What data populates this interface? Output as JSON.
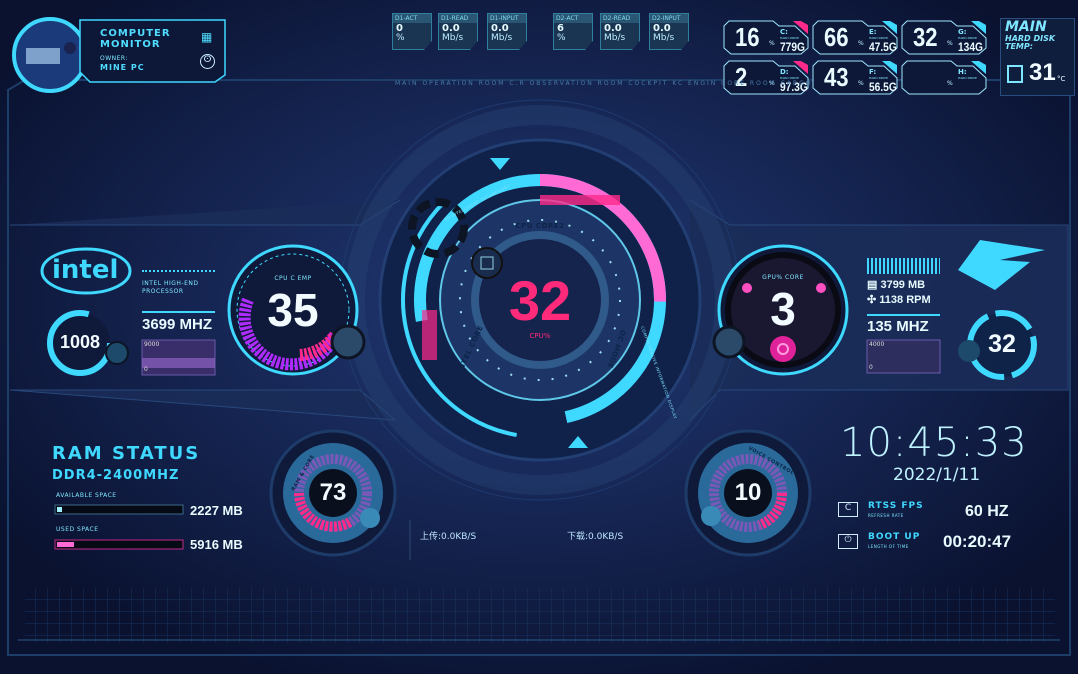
{
  "profile": {
    "title_line1": "COMPUTER",
    "title_line2": "MONITOR",
    "owner_label": "OWNER:",
    "owner": "MINE PC"
  },
  "disk_io": [
    {
      "label": "D1-ACT",
      "value": "0",
      "unit": "%"
    },
    {
      "label": "D1-READ",
      "value": "0.0",
      "unit": "Mb/s"
    },
    {
      "label": "D1-INPUT",
      "value": "0.0",
      "unit": "Mb/s"
    },
    {
      "label": "D2-ACT",
      "value": "6",
      "unit": "%"
    },
    {
      "label": "D2-READ",
      "value": "0.0",
      "unit": "Mb/s"
    },
    {
      "label": "D2-INPUT",
      "value": "0.0",
      "unit": "Mb/s"
    }
  ],
  "drives": [
    {
      "pct": "16",
      "unit": "%",
      "letter": "C:",
      "sub": "HARD DRIVE",
      "size": "779G",
      "accent": "#ff2a8a"
    },
    {
      "pct": "66",
      "unit": "%",
      "letter": "E:",
      "sub": "HARD DRIVE",
      "size": "47.5G",
      "accent": "#3fd8ff"
    },
    {
      "pct": "32",
      "unit": "%",
      "letter": "G:",
      "sub": "HARD DRIVE",
      "size": "134G",
      "accent": "#3fd8ff"
    },
    {
      "pct": "2",
      "unit": "%",
      "letter": "D:",
      "sub": "HARD DRIVE",
      "size": "97.3G",
      "accent": "#ff2a8a"
    },
    {
      "pct": "43",
      "unit": "%",
      "letter": "F:",
      "sub": "HARD DRIVE",
      "size": "56.5G",
      "accent": "#3fd8ff"
    },
    {
      "pct": "",
      "unit": "%",
      "letter": "H:",
      "sub": "HARD DRIVE",
      "size": "",
      "accent": "#3fd8ff"
    }
  ],
  "disk_temp": {
    "line1": "MAIN",
    "line2": "HARD DISK",
    "line3": "TEMP:",
    "value": "31",
    "unit": "°C"
  },
  "ring_labels": {
    "top": "MAIN OPERATION ROOM   C.R   OBSERVATION ROOM COCKPIT KC  ENGIN CORE ROOM CARGO"
  },
  "cpu": {
    "brand": "intel",
    "processor_line1": "INTEL HIGH-END",
    "processor_line2": "PROCESSOR",
    "fan": "1008",
    "clock": "3699 MHZ",
    "chart_max": "9000",
    "chart_min": "0",
    "temp_label": "CPU C EMP",
    "temp": "35",
    "usage": "32",
    "usage_label": "CPU%",
    "core_label": "CPU CORE2",
    "intel_core": "INTEL CORE",
    "oc_mode": "OC MODE",
    "tech": "3D INTELLIGENT TECHNOLOGY",
    "display": "COMPREHENSIVE INFORMATION DISPLAY"
  },
  "gpu": {
    "core_label": "GPU% CORE",
    "usage": "3",
    "memory": "3799 MB",
    "fan": "1138 RPM",
    "clock": "135 MHZ",
    "chart_max": "4000",
    "chart_min": "0",
    "temp": "32"
  },
  "ram": {
    "title": "RAM STATUS",
    "type": "DDR4-2400MHZ",
    "available_label": "AVAILABLE SPACE",
    "available": "2227 MB",
    "available_fraction": 0.04,
    "used_label": "USED SPACE",
    "used": "5916 MB",
    "used_fraction": 0.14,
    "gauge_label": "RAM & CORE",
    "gauge": "73"
  },
  "volume": {
    "label": "VOICE CONTROL",
    "value": "10"
  },
  "network": {
    "upload": "上传:0.0KB/S",
    "download": "下载:0.0KB/S"
  },
  "clock": {
    "time": "10:45:33",
    "date": "2022/1/11"
  },
  "rtss": {
    "title": "RTSS FPS",
    "sub": "REFRESH RATE",
    "value": "60 HZ"
  },
  "boot": {
    "title": "BOOT UP",
    "sub": "LENGTH OF TIME",
    "value": "00:20:47"
  },
  "colors": {
    "accent": "#4fdcff",
    "pink": "#ff2a8a",
    "bg": "#0a1230"
  }
}
